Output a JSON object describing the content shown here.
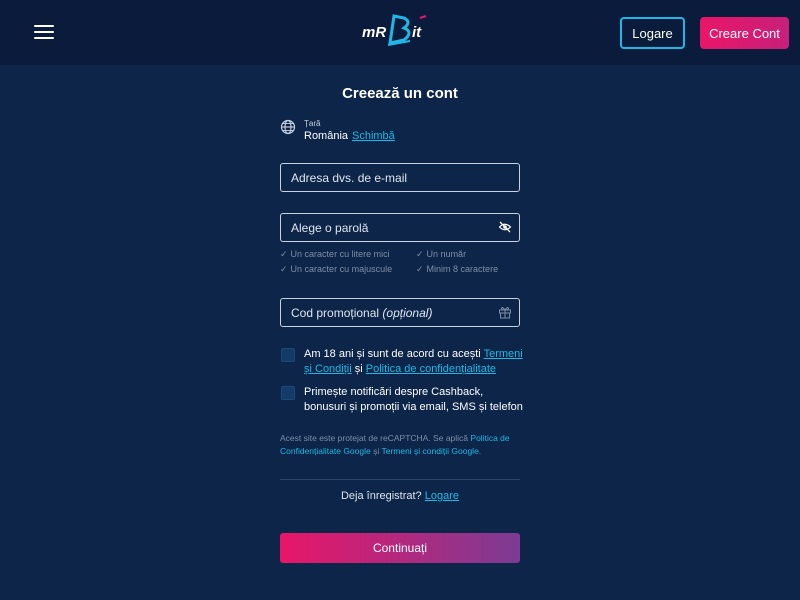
{
  "header": {
    "logo_text": "MRBit",
    "login_label": "Logare",
    "create_label": "Creare Cont"
  },
  "form": {
    "title": "Creează un cont",
    "country": {
      "label": "Țară",
      "value": "România",
      "change_label": "Schimbă"
    },
    "email_placeholder": "Adresa dvs. de e-mail",
    "password_placeholder": "Alege o parolă",
    "requirements": [
      "Un caracter cu litere mici",
      "Un număr",
      "Un caracter cu majuscule",
      "Minim 8 caractere"
    ],
    "promo": {
      "label": "Cod promoțional",
      "optional": "(opțional)"
    },
    "consent_terms": {
      "prefix": "Am 18 ani și sunt de acord cu acești",
      "terms_link": "Termeni și Condiții",
      "and": "și",
      "privacy_link": "Politica de confidențialitate"
    },
    "consent_marketing": "Primește notificări despre Cashback, bonusuri și promoții via email, SMS și telefon",
    "captcha": {
      "prefix": "Acest site este protejat de reCAPTCHA. Se aplică",
      "privacy_link": "Politica de Confidențialitate Google",
      "and": "și",
      "terms_link": "Termeni și condiții Google",
      "suffix": "."
    },
    "already_registered": "Deja înregistrat?",
    "login_link": "Logare",
    "continue_label": "Continuați"
  },
  "colors": {
    "background": "#0c2549",
    "header": "#0a1b3b",
    "accent_blue": "#1fb8e6",
    "accent_pink": "#e91668",
    "accent_purple": "#7c3b94"
  },
  "icons": {
    "menu": "hamburger-icon",
    "country": "globe-icon",
    "password_toggle": "eye-off-icon",
    "promo": "gift-icon",
    "requirement": "check-icon"
  }
}
